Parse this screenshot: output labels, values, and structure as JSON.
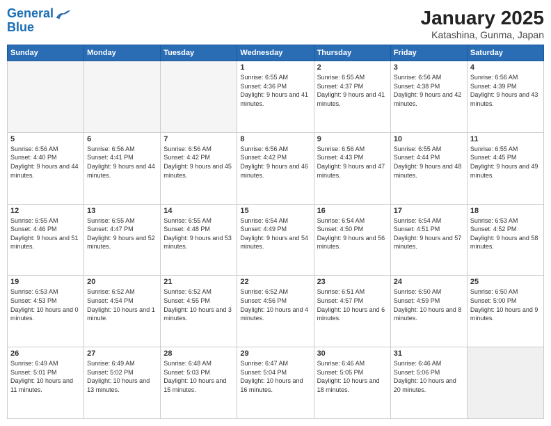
{
  "header": {
    "logo_text1": "General",
    "logo_text2": "Blue",
    "title": "January 2025",
    "subtitle": "Katashina, Gunma, Japan"
  },
  "weekdays": [
    "Sunday",
    "Monday",
    "Tuesday",
    "Wednesday",
    "Thursday",
    "Friday",
    "Saturday"
  ],
  "weeks": [
    [
      {
        "day": "",
        "empty": true
      },
      {
        "day": "",
        "empty": true
      },
      {
        "day": "",
        "empty": true
      },
      {
        "day": "1",
        "sunrise": "6:55 AM",
        "sunset": "4:36 PM",
        "daylight": "9 hours and 41 minutes."
      },
      {
        "day": "2",
        "sunrise": "6:55 AM",
        "sunset": "4:37 PM",
        "daylight": "9 hours and 41 minutes."
      },
      {
        "day": "3",
        "sunrise": "6:56 AM",
        "sunset": "4:38 PM",
        "daylight": "9 hours and 42 minutes."
      },
      {
        "day": "4",
        "sunrise": "6:56 AM",
        "sunset": "4:39 PM",
        "daylight": "9 hours and 43 minutes."
      }
    ],
    [
      {
        "day": "5",
        "sunrise": "6:56 AM",
        "sunset": "4:40 PM",
        "daylight": "9 hours and 44 minutes."
      },
      {
        "day": "6",
        "sunrise": "6:56 AM",
        "sunset": "4:41 PM",
        "daylight": "9 hours and 44 minutes."
      },
      {
        "day": "7",
        "sunrise": "6:56 AM",
        "sunset": "4:42 PM",
        "daylight": "9 hours and 45 minutes."
      },
      {
        "day": "8",
        "sunrise": "6:56 AM",
        "sunset": "4:42 PM",
        "daylight": "9 hours and 46 minutes."
      },
      {
        "day": "9",
        "sunrise": "6:56 AM",
        "sunset": "4:43 PM",
        "daylight": "9 hours and 47 minutes."
      },
      {
        "day": "10",
        "sunrise": "6:55 AM",
        "sunset": "4:44 PM",
        "daylight": "9 hours and 48 minutes."
      },
      {
        "day": "11",
        "sunrise": "6:55 AM",
        "sunset": "4:45 PM",
        "daylight": "9 hours and 49 minutes."
      }
    ],
    [
      {
        "day": "12",
        "sunrise": "6:55 AM",
        "sunset": "4:46 PM",
        "daylight": "9 hours and 51 minutes."
      },
      {
        "day": "13",
        "sunrise": "6:55 AM",
        "sunset": "4:47 PM",
        "daylight": "9 hours and 52 minutes."
      },
      {
        "day": "14",
        "sunrise": "6:55 AM",
        "sunset": "4:48 PM",
        "daylight": "9 hours and 53 minutes."
      },
      {
        "day": "15",
        "sunrise": "6:54 AM",
        "sunset": "4:49 PM",
        "daylight": "9 hours and 54 minutes."
      },
      {
        "day": "16",
        "sunrise": "6:54 AM",
        "sunset": "4:50 PM",
        "daylight": "9 hours and 56 minutes."
      },
      {
        "day": "17",
        "sunrise": "6:54 AM",
        "sunset": "4:51 PM",
        "daylight": "9 hours and 57 minutes."
      },
      {
        "day": "18",
        "sunrise": "6:53 AM",
        "sunset": "4:52 PM",
        "daylight": "9 hours and 58 minutes."
      }
    ],
    [
      {
        "day": "19",
        "sunrise": "6:53 AM",
        "sunset": "4:53 PM",
        "daylight": "10 hours and 0 minutes."
      },
      {
        "day": "20",
        "sunrise": "6:52 AM",
        "sunset": "4:54 PM",
        "daylight": "10 hours and 1 minute."
      },
      {
        "day": "21",
        "sunrise": "6:52 AM",
        "sunset": "4:55 PM",
        "daylight": "10 hours and 3 minutes."
      },
      {
        "day": "22",
        "sunrise": "6:52 AM",
        "sunset": "4:56 PM",
        "daylight": "10 hours and 4 minutes."
      },
      {
        "day": "23",
        "sunrise": "6:51 AM",
        "sunset": "4:57 PM",
        "daylight": "10 hours and 6 minutes."
      },
      {
        "day": "24",
        "sunrise": "6:50 AM",
        "sunset": "4:59 PM",
        "daylight": "10 hours and 8 minutes."
      },
      {
        "day": "25",
        "sunrise": "6:50 AM",
        "sunset": "5:00 PM",
        "daylight": "10 hours and 9 minutes."
      }
    ],
    [
      {
        "day": "26",
        "sunrise": "6:49 AM",
        "sunset": "5:01 PM",
        "daylight": "10 hours and 11 minutes."
      },
      {
        "day": "27",
        "sunrise": "6:49 AM",
        "sunset": "5:02 PM",
        "daylight": "10 hours and 13 minutes."
      },
      {
        "day": "28",
        "sunrise": "6:48 AM",
        "sunset": "5:03 PM",
        "daylight": "10 hours and 15 minutes."
      },
      {
        "day": "29",
        "sunrise": "6:47 AM",
        "sunset": "5:04 PM",
        "daylight": "10 hours and 16 minutes."
      },
      {
        "day": "30",
        "sunrise": "6:46 AM",
        "sunset": "5:05 PM",
        "daylight": "10 hours and 18 minutes."
      },
      {
        "day": "31",
        "sunrise": "6:46 AM",
        "sunset": "5:06 PM",
        "daylight": "10 hours and 20 minutes."
      },
      {
        "day": "",
        "empty": true
      }
    ]
  ]
}
